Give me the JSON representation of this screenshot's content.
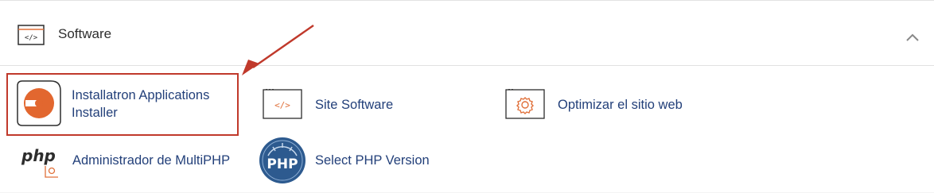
{
  "section": {
    "title": "Software",
    "header_icon": "code-window-icon",
    "collapse_icon": "chevron-up-icon"
  },
  "apps": {
    "installatron": {
      "label": "Installatron Applications Installer",
      "icon": "installatron-logo-icon",
      "highlighted": true
    },
    "site_software": {
      "label": "Site Software",
      "icon": "code-window-icon"
    },
    "optimize": {
      "label": "Optimizar el sitio web",
      "icon": "gear-window-icon"
    },
    "multiphp_manager": {
      "label": "Administrador de MultiPHP",
      "icon": "php-gear-icon"
    },
    "select_php": {
      "label": "Select PHP Version",
      "icon": "php-badge-icon"
    }
  },
  "colors": {
    "link": "#23407a",
    "accent_orange": "#e0703a",
    "highlight_red": "#c0392b",
    "php_badge_blue": "#2d5a8f"
  }
}
